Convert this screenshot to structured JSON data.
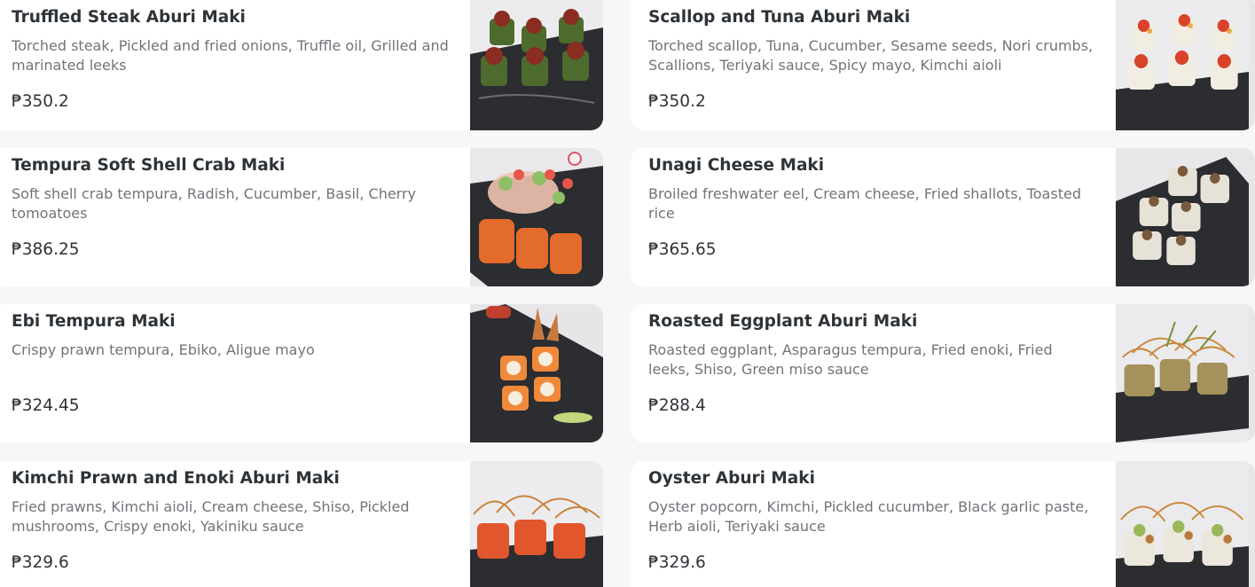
{
  "menu_items": [
    {
      "name": "Truffled Steak Aburi Maki",
      "description": "Torched steak, Pickled and fried onions, Truffle oil, Grilled and marinated leeks",
      "price": "₱350.2",
      "image_alt": "truffled-steak-aburi-maki-photo"
    },
    {
      "name": "Scallop and Tuna Aburi Maki",
      "description": "Torched scallop, Tuna, Cucumber, Sesame seeds, Nori crumbs, Scallions, Teriyaki sauce, Spicy mayo, Kimchi aioli",
      "price": "₱350.2",
      "image_alt": "scallop-tuna-aburi-maki-photo"
    },
    {
      "name": "Tempura Soft Shell Crab Maki",
      "description": "Soft shell crab tempura, Radish, Cucumber, Basil, Cherry tomoatoes",
      "price": "₱386.25",
      "image_alt": "tempura-soft-shell-crab-maki-photo"
    },
    {
      "name": "Unagi Cheese Maki",
      "description": "Broiled freshwater eel, Cream cheese, Fried shallots, Toasted rice",
      "price": "₱365.65",
      "image_alt": "unagi-cheese-maki-photo"
    },
    {
      "name": "Ebi Tempura Maki",
      "description": "Crispy prawn tempura, Ebiko, Aligue mayo",
      "price": "₱324.45",
      "image_alt": "ebi-tempura-maki-photo"
    },
    {
      "name": "Roasted Eggplant Aburi Maki",
      "description": "Roasted eggplant, Asparagus tempura, Fried enoki, Fried leeks, Shiso, Green miso sauce",
      "price": "₱288.4",
      "image_alt": "roasted-eggplant-aburi-maki-photo"
    },
    {
      "name": "Kimchi Prawn and Enoki Aburi Maki",
      "description": "Fried prawns, Kimchi aioli, Cream cheese, Shiso, Pickled mushrooms, Crispy enoki, Yakiniku sauce",
      "price": "₱329.6",
      "image_alt": "kimchi-prawn-enoki-aburi-maki-photo"
    },
    {
      "name": "Oyster Aburi Maki",
      "description": "Oyster popcorn, Kimchi, Pickled cucumber, Black garlic paste, Herb aioli, Teriyaki sauce",
      "price": "₱329.6",
      "image_alt": "oyster-aburi-maki-photo"
    }
  ],
  "colors": {
    "background": "#f7f7f7",
    "card": "#ffffff",
    "title": "#2e3338",
    "description": "#707479",
    "slate": "#2a2c2f"
  }
}
